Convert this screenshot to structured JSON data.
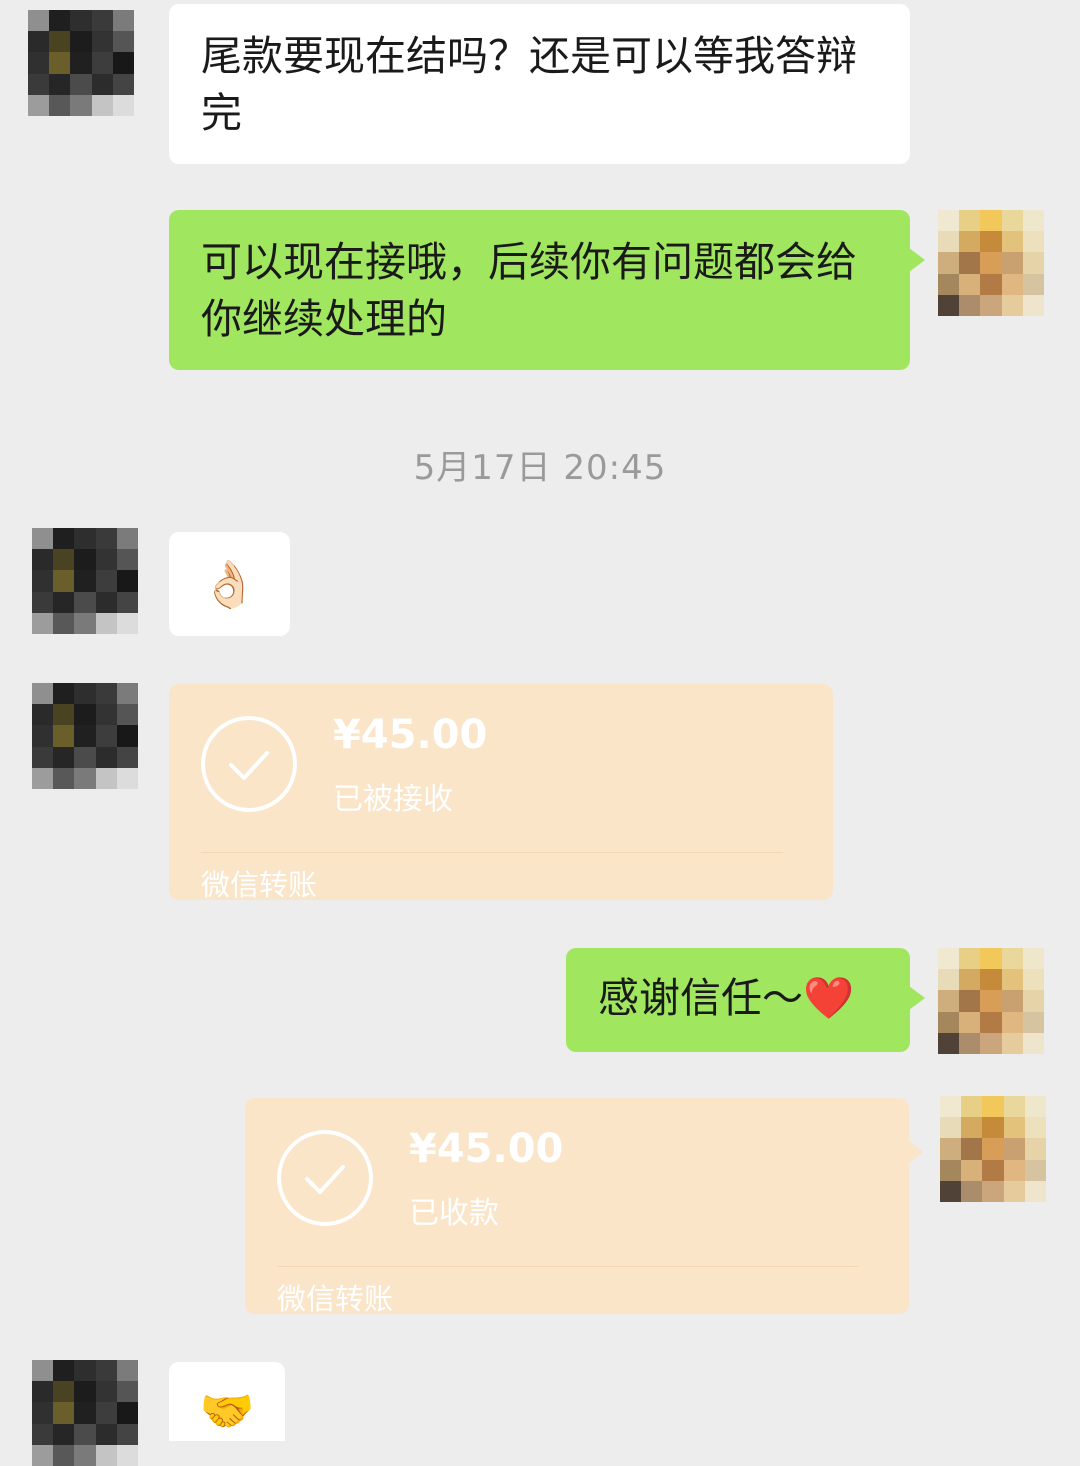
{
  "messages": {
    "m1": "尾款要现在结吗？还是可以等我答辩完",
    "m2": "可以现在接哦，后续你有问题都会给你继续处理的",
    "timestamp": "5月17日 20:45",
    "m3_emoji": "👌🏻",
    "transfer1": {
      "amount": "¥45.00",
      "status": "已被接收",
      "footer": "微信转账"
    },
    "m4": "感谢信任～",
    "m4_emoji": "❤️",
    "transfer2": {
      "amount": "¥45.00",
      "status": "已收款",
      "footer": "微信转账"
    },
    "m5_emoji": "🤝"
  },
  "colors": {
    "background": "#ededed",
    "self_bubble": "#a0e65f",
    "other_bubble": "#ffffff",
    "transfer_card": "#fae5c9"
  }
}
